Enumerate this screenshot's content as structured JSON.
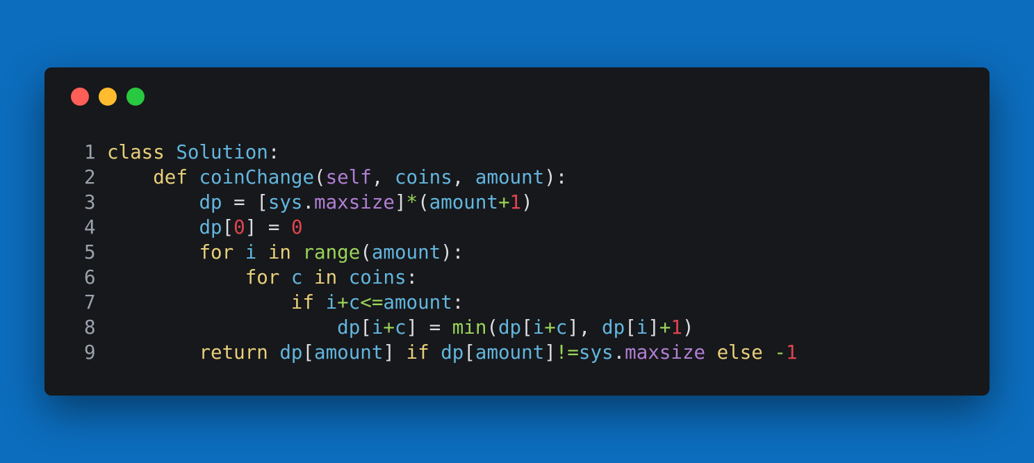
{
  "colors": {
    "background": "#0c6dbe",
    "window": "#17181b",
    "dot_red": "#ff5f57",
    "dot_yellow": "#febc2e",
    "dot_green": "#28c840",
    "line_number": "#9aa3ad",
    "keyword": "#e7cf7a",
    "identifier": "#62b6df",
    "builtin": "#9ad45a",
    "self": "#b07fd4",
    "attribute": "#b07fd4",
    "number": "#e0454f",
    "punctuation": "#dcdde0"
  },
  "window": {
    "controls": [
      "close-dot",
      "minimize-dot",
      "zoom-dot"
    ]
  },
  "code": {
    "lines": [
      {
        "number": "1",
        "indent": "",
        "tokens": [
          {
            "t": "class",
            "k": "keyword"
          },
          {
            "t": " ",
            "k": "punctuation"
          },
          {
            "t": "Solution",
            "k": "identifier"
          },
          {
            "t": ":",
            "k": "punctuation"
          }
        ]
      },
      {
        "number": "2",
        "indent": "    ",
        "tokens": [
          {
            "t": "def",
            "k": "keyword"
          },
          {
            "t": " ",
            "k": "punctuation"
          },
          {
            "t": "coinChange",
            "k": "identifier"
          },
          {
            "t": "(",
            "k": "punctuation"
          },
          {
            "t": "self",
            "k": "self"
          },
          {
            "t": ", ",
            "k": "punctuation"
          },
          {
            "t": "coins",
            "k": "identifier"
          },
          {
            "t": ", ",
            "k": "punctuation"
          },
          {
            "t": "amount",
            "k": "identifier"
          },
          {
            "t": "):",
            "k": "punctuation"
          }
        ]
      },
      {
        "number": "3",
        "indent": "        ",
        "tokens": [
          {
            "t": "dp",
            "k": "identifier"
          },
          {
            "t": " = [",
            "k": "punctuation"
          },
          {
            "t": "sys",
            "k": "identifier"
          },
          {
            "t": ".",
            "k": "punctuation"
          },
          {
            "t": "maxsize",
            "k": "attribute"
          },
          {
            "t": "]",
            "k": "punctuation"
          },
          {
            "t": "*",
            "k": "builtin"
          },
          {
            "t": "(",
            "k": "punctuation"
          },
          {
            "t": "amount",
            "k": "identifier"
          },
          {
            "t": "+",
            "k": "builtin"
          },
          {
            "t": "1",
            "k": "number"
          },
          {
            "t": ")",
            "k": "punctuation"
          }
        ]
      },
      {
        "number": "4",
        "indent": "        ",
        "tokens": [
          {
            "t": "dp",
            "k": "identifier"
          },
          {
            "t": "[",
            "k": "punctuation"
          },
          {
            "t": "0",
            "k": "number"
          },
          {
            "t": "] = ",
            "k": "punctuation"
          },
          {
            "t": "0",
            "k": "number"
          }
        ]
      },
      {
        "number": "5",
        "indent": "        ",
        "tokens": [
          {
            "t": "for",
            "k": "keyword"
          },
          {
            "t": " ",
            "k": "punctuation"
          },
          {
            "t": "i",
            "k": "identifier"
          },
          {
            "t": " ",
            "k": "punctuation"
          },
          {
            "t": "in",
            "k": "keyword"
          },
          {
            "t": " ",
            "k": "punctuation"
          },
          {
            "t": "range",
            "k": "builtin"
          },
          {
            "t": "(",
            "k": "punctuation"
          },
          {
            "t": "amount",
            "k": "identifier"
          },
          {
            "t": "):",
            "k": "punctuation"
          }
        ]
      },
      {
        "number": "6",
        "indent": "            ",
        "tokens": [
          {
            "t": "for",
            "k": "keyword"
          },
          {
            "t": " ",
            "k": "punctuation"
          },
          {
            "t": "c",
            "k": "identifier"
          },
          {
            "t": " ",
            "k": "punctuation"
          },
          {
            "t": "in",
            "k": "keyword"
          },
          {
            "t": " ",
            "k": "punctuation"
          },
          {
            "t": "coins",
            "k": "identifier"
          },
          {
            "t": ":",
            "k": "punctuation"
          }
        ]
      },
      {
        "number": "7",
        "indent": "                ",
        "tokens": [
          {
            "t": "if",
            "k": "keyword"
          },
          {
            "t": " ",
            "k": "punctuation"
          },
          {
            "t": "i",
            "k": "identifier"
          },
          {
            "t": "+",
            "k": "builtin"
          },
          {
            "t": "c",
            "k": "identifier"
          },
          {
            "t": "<=",
            "k": "builtin"
          },
          {
            "t": "amount",
            "k": "identifier"
          },
          {
            "t": ":",
            "k": "punctuation"
          }
        ]
      },
      {
        "number": "8",
        "indent": "                    ",
        "tokens": [
          {
            "t": "dp",
            "k": "identifier"
          },
          {
            "t": "[",
            "k": "punctuation"
          },
          {
            "t": "i",
            "k": "identifier"
          },
          {
            "t": "+",
            "k": "builtin"
          },
          {
            "t": "c",
            "k": "identifier"
          },
          {
            "t": "] = ",
            "k": "punctuation"
          },
          {
            "t": "min",
            "k": "builtin"
          },
          {
            "t": "(",
            "k": "punctuation"
          },
          {
            "t": "dp",
            "k": "identifier"
          },
          {
            "t": "[",
            "k": "punctuation"
          },
          {
            "t": "i",
            "k": "identifier"
          },
          {
            "t": "+",
            "k": "builtin"
          },
          {
            "t": "c",
            "k": "identifier"
          },
          {
            "t": "], ",
            "k": "punctuation"
          },
          {
            "t": "dp",
            "k": "identifier"
          },
          {
            "t": "[",
            "k": "punctuation"
          },
          {
            "t": "i",
            "k": "identifier"
          },
          {
            "t": "]",
            "k": "punctuation"
          },
          {
            "t": "+",
            "k": "builtin"
          },
          {
            "t": "1",
            "k": "number"
          },
          {
            "t": ")",
            "k": "punctuation"
          }
        ]
      },
      {
        "number": "9",
        "indent": "        ",
        "tokens": [
          {
            "t": "return",
            "k": "keyword"
          },
          {
            "t": " ",
            "k": "punctuation"
          },
          {
            "t": "dp",
            "k": "identifier"
          },
          {
            "t": "[",
            "k": "punctuation"
          },
          {
            "t": "amount",
            "k": "identifier"
          },
          {
            "t": "] ",
            "k": "punctuation"
          },
          {
            "t": "if",
            "k": "keyword"
          },
          {
            "t": " ",
            "k": "punctuation"
          },
          {
            "t": "dp",
            "k": "identifier"
          },
          {
            "t": "[",
            "k": "punctuation"
          },
          {
            "t": "amount",
            "k": "identifier"
          },
          {
            "t": "]",
            "k": "punctuation"
          },
          {
            "t": "!=",
            "k": "builtin"
          },
          {
            "t": "sys",
            "k": "identifier"
          },
          {
            "t": ".",
            "k": "punctuation"
          },
          {
            "t": "maxsize",
            "k": "attribute"
          },
          {
            "t": " ",
            "k": "punctuation"
          },
          {
            "t": "else",
            "k": "keyword"
          },
          {
            "t": " ",
            "k": "punctuation"
          },
          {
            "t": "-",
            "k": "builtin"
          },
          {
            "t": "1",
            "k": "number"
          }
        ]
      }
    ]
  }
}
